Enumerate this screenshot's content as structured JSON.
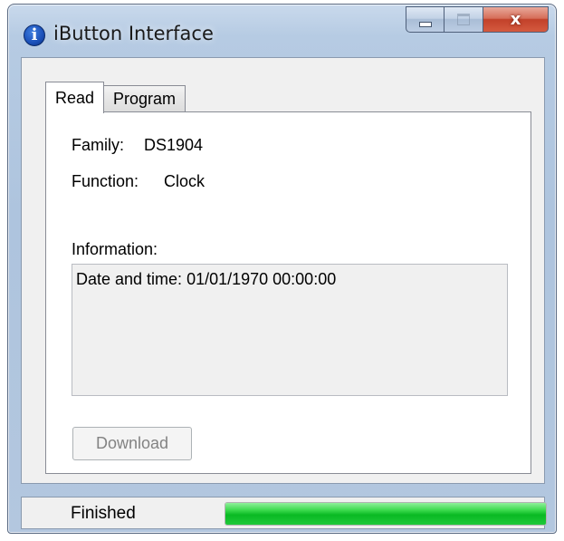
{
  "window": {
    "title": "iButton Interface",
    "icon": "info-icon",
    "controls": {
      "minimize": "minimize-icon",
      "maximize": "maximize-icon",
      "close_label": "x"
    }
  },
  "tabs": [
    {
      "label": "Read",
      "selected": true
    },
    {
      "label": "Program",
      "selected": false
    }
  ],
  "read": {
    "family_label": "Family:",
    "family_value": "DS1904",
    "function_label": "Function:",
    "function_value": "Clock",
    "info_label": "Information:",
    "info_text": "Date and time: 01/01/1970 00:00:00",
    "download_label": "Download",
    "download_enabled": false
  },
  "status": {
    "text": "Finished",
    "progress_percent": 100
  },
  "colors": {
    "progress_green": "#0ab923",
    "close_red": "#c2412a",
    "titlebar_blue": "#aec4de"
  }
}
